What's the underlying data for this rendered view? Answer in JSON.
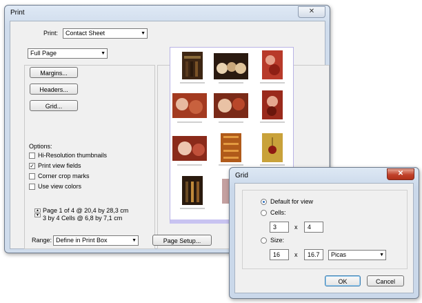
{
  "print_dialog": {
    "title": "Print",
    "print_label": "Print:",
    "print_value": "Contact Sheet",
    "page_mode": "Full Page",
    "buttons": {
      "margins": "Margins...",
      "headers": "Headers...",
      "grid": "Grid..."
    },
    "options_label": "Options:",
    "options": [
      {
        "label": "Hi-Resolution thumbnails",
        "checked": false
      },
      {
        "label": "Print view fields",
        "checked": true
      },
      {
        "label": "Corner crop marks",
        "checked": false
      },
      {
        "label": "Use view colors",
        "checked": false
      }
    ],
    "page_info_1": "Page 1 of 4 @ 20,4 by 28,3 cm",
    "page_info_2": "3 by 4 Cells @ 6,8 by 7,1 cm",
    "range_label": "Range:",
    "range_value": "Define in Print Box",
    "page_setup": "Page Setup..."
  },
  "grid_dialog": {
    "title": "Grid",
    "default_label": "Default for view",
    "cells_label": "Cells:",
    "cells_cols": "3",
    "cells_rows": "4",
    "x_sep": "x",
    "size_label": "Size:",
    "size_w": "16",
    "size_h": "16.7",
    "unit": "Picas",
    "ok": "OK",
    "cancel": "Cancel",
    "selected": "default"
  },
  "icons": {
    "close": "close-icon",
    "dropdown": "chevron-down-icon"
  }
}
